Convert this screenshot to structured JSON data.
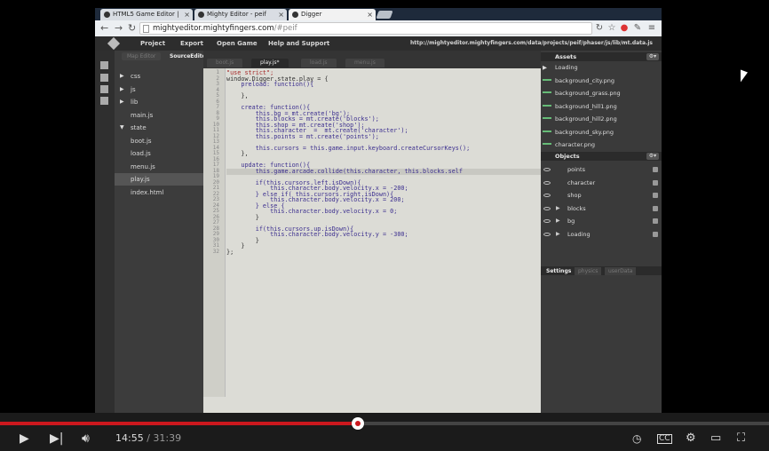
{
  "browser": {
    "tabs": [
      {
        "label": "HTML5 Game Editor | "
      },
      {
        "label": "Mighty Editor - peif"
      },
      {
        "label": "Digger"
      }
    ],
    "url_host": "mightyeditor.mightyfingers.com",
    "url_path": "/#peif"
  },
  "app": {
    "menu": [
      "Project",
      "Export",
      "Open Game",
      "Help and Support"
    ],
    "file_path": "http://mightyeditor.mightyfingers.com/data/projects/peif/phaser/js/lib/mt.data.js",
    "panel_tabs": [
      "Map Editor",
      "SourceEditor"
    ]
  },
  "filetree": [
    {
      "label": "css",
      "arrow": "▶",
      "indent": 1
    },
    {
      "label": "js",
      "arrow": "▶",
      "indent": 1
    },
    {
      "label": "lib",
      "arrow": "▶",
      "indent": 1
    },
    {
      "label": "main.js",
      "arrow": "",
      "indent": 1
    },
    {
      "label": "state",
      "arrow": "▼",
      "indent": 1
    },
    {
      "label": "boot.js",
      "arrow": "",
      "indent": 2
    },
    {
      "label": "load.js",
      "arrow": "",
      "indent": 2
    },
    {
      "label": "menu.js",
      "arrow": "",
      "indent": 2
    },
    {
      "label": "play.js",
      "arrow": "",
      "indent": 2,
      "selected": true
    },
    {
      "label": "index.html",
      "arrow": "",
      "indent": 1
    }
  ],
  "editor": {
    "tabs": [
      "boot.js",
      "play.js*",
      "load.js",
      "menu.js"
    ],
    "active_tab": 1,
    "lines": [
      "\"use strict\";",
      "window.Digger.state.play = {",
      "    preload: function(){",
      "",
      "    },",
      "",
      "    create: function(){",
      "        this.bg = mt.create('bg');",
      "        this.blocks = mt.create('blocks');",
      "        this.shop = mt.create('shop');",
      "        this.character  =  mt.create('character');",
      "        this.points = mt.create('points');",
      "",
      "        this.cursors = this.game.input.keyboard.createCursorKeys();",
      "    },",
      "",
      "    update: function(){",
      "        this.game.arcade.collide(this.character, this.blocks.self",
      "",
      "        if(this.cursors.left.isDown){",
      "            this.character.body.velocity.x = -200;",
      "        } else if( this.cursors.right.isDown){",
      "            this.character.body.velocity.x = 200;",
      "        } else {",
      "            this.character.body.velocity.x = 0;",
      "        }",
      "",
      "        if(this.cursors.up.isDown){",
      "            this.character.body.velocity.y = -300;",
      "        }",
      "    }",
      "};"
    ],
    "highlight_line": 18
  },
  "assets": {
    "title": "Assets",
    "items": [
      "Loading",
      "background_city.png",
      "background_grass.png",
      "background_hill1.png",
      "background_hill2.png",
      "background_sky.png",
      "character.png"
    ]
  },
  "objects": {
    "title": "Objects",
    "items": [
      "points",
      "character",
      "shop",
      "blocks",
      "bg",
      "Loading"
    ]
  },
  "settings_tabs": [
    "Settings",
    "physics",
    "userData"
  ],
  "player": {
    "current_time": "14:55",
    "separator": "/",
    "duration": "31:39",
    "progress": 0.4715
  },
  "colors": {
    "progress": "#cc181e",
    "editor_bg": "#dcdcd6"
  }
}
